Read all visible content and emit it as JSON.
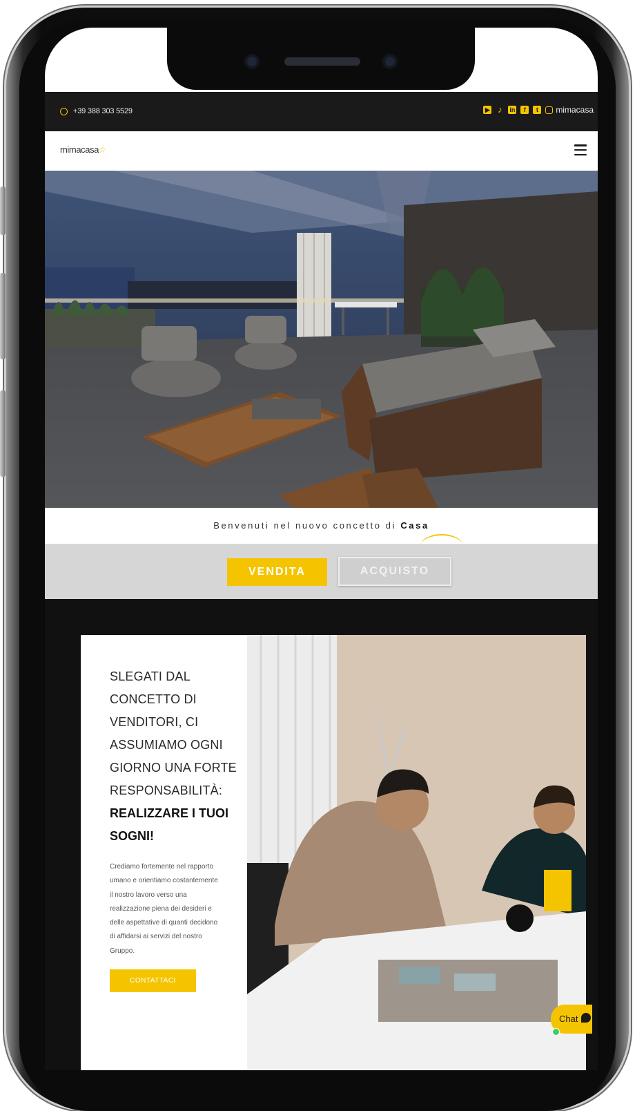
{
  "topbar": {
    "phone": "+39 388 303 5529",
    "social_icons": [
      "youtube-icon",
      "tiktok-icon",
      "linkedin-icon",
      "facebook-icon",
      "twitter-icon",
      "instagram-icon"
    ],
    "handle": "mimacasa"
  },
  "header": {
    "logo": "mimacasa",
    "menu_icon": "hamburger-menu-icon"
  },
  "welcome": {
    "prefix": "Benvenuti nel nuovo concetto di ",
    "highlight": "Casa"
  },
  "tabs": {
    "vendita": "VENDITA",
    "acquisto": "ACQUISTO"
  },
  "card": {
    "headline": "SLEGATI DAL CONCETTO DI VENDITORI, CI ASSUMIAMO OGNI GIORNO UNA FORTE RESPONSABILITÀ:",
    "headline_strong": "REALIZZARE I TUOI SOGNI!",
    "body": "Crediamo fortemente nel rapporto umano e orientiamo costantemente il nostro lavoro verso una realizzazione piena dei desideri e delle aspettative di quanti decidono di affidarsi ai servizi del nostro Gruppo.",
    "cta": "CONTATTACI"
  },
  "chat": {
    "label": "Chat"
  },
  "colors": {
    "accent": "#f5c400",
    "topbar": "#1a1a1a",
    "section_dark": "#111111",
    "tabs_bg": "#d6d6d6"
  }
}
